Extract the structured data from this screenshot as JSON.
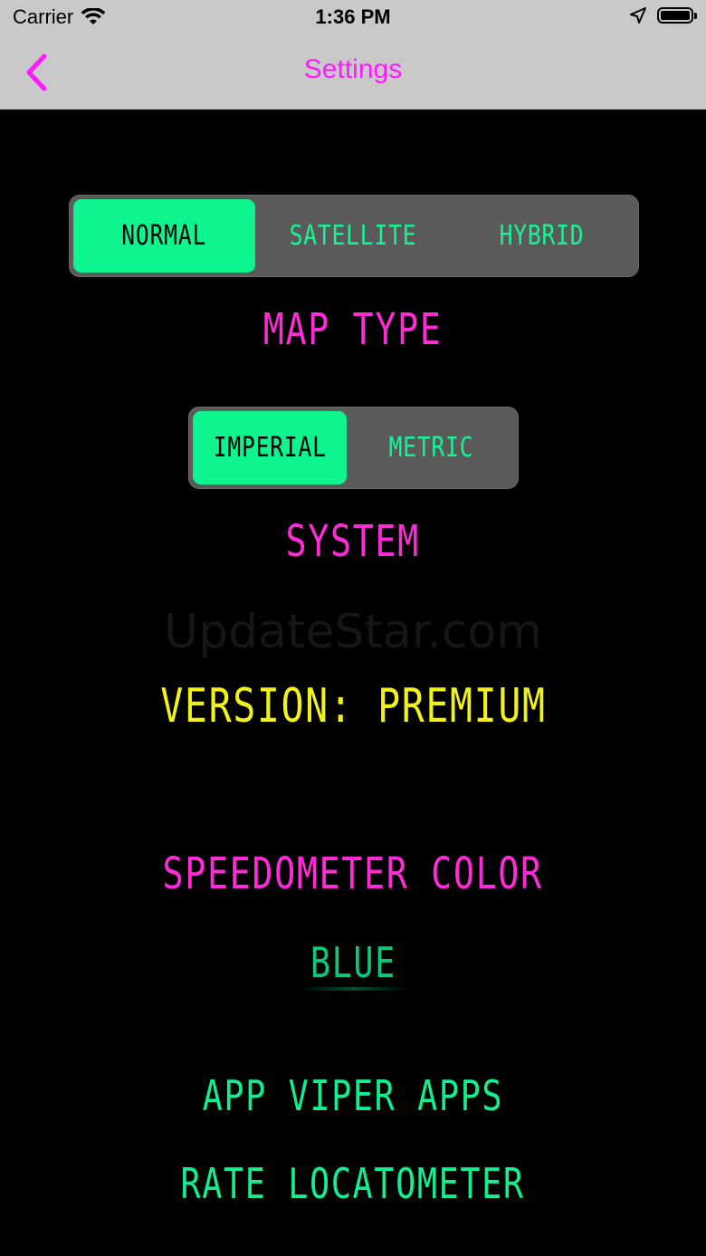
{
  "status_bar": {
    "carrier": "Carrier",
    "time": "1:36 PM"
  },
  "nav": {
    "title": "Settings",
    "back_icon": "chevron-left-icon",
    "accent_color": "#ff1aff"
  },
  "map_type": {
    "options": [
      "NORMAL",
      "SATELLITE",
      "HYBRID"
    ],
    "selected": "NORMAL",
    "label": "MAP TYPE"
  },
  "unit_system": {
    "options": [
      "IMPERIAL",
      "METRIC"
    ],
    "selected": "IMPERIAL",
    "label": "SYSTEM"
  },
  "watermark": "UpdateStar.com",
  "version": "VERSION: PREMIUM",
  "speedometer": {
    "label": "SPEEDOMETER COLOR",
    "selected_color": "BLUE"
  },
  "links": {
    "app_viper": "APP VIPER APPS",
    "rate": "RATE LOCATOMETER"
  },
  "colors": {
    "lcd_green": "#12f08e",
    "lcd_pink": "#ff2bd6",
    "lcd_yellow": "#f2f21a",
    "segment_bg": "#5a5a5a"
  }
}
